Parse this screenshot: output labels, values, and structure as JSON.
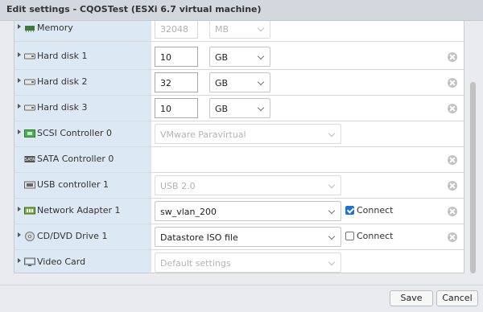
{
  "window": {
    "title": "Edit settings - CQOSTest (ESXi 6.7 virtual machine)"
  },
  "colors": {
    "label_column": "#dce8f3",
    "accent": "#1b73d8"
  },
  "rows": [
    {
      "label": "Memory",
      "icon": "memory-icon",
      "value": "32048",
      "unit": "MB",
      "disabled": true
    },
    {
      "label": "Hard disk 1",
      "icon": "hard-disk-icon",
      "value": "10",
      "unit": "GB"
    },
    {
      "label": "Hard disk 2",
      "icon": "hard-disk-icon",
      "value": "32",
      "unit": "GB"
    },
    {
      "label": "Hard disk 3",
      "icon": "hard-disk-icon",
      "value": "10",
      "unit": "GB"
    },
    {
      "label": "SCSI Controller 0",
      "icon": "scsi-controller-icon",
      "select": "VMware Paravirtual",
      "disabled": true
    },
    {
      "label": "SATA Controller 0",
      "icon": "sata-controller-icon"
    },
    {
      "label": "USB controller 1",
      "icon": "usb-icon",
      "select": "USB 2.0",
      "disabled": true
    },
    {
      "label": "Network Adapter 1",
      "icon": "network-adapter-icon",
      "select": "sw_vlan_200",
      "connect_label": "Connect",
      "connected": true
    },
    {
      "label": "CD/DVD Drive 1",
      "icon": "cd-dvd-icon",
      "select": "Datastore ISO file",
      "connect_label": "Connect",
      "connected": false
    },
    {
      "label": "Video Card",
      "icon": "video-card-icon",
      "select": "Default settings",
      "disabled": true
    }
  ],
  "footer": {
    "save_label": "Save",
    "cancel_label": "Cancel"
  }
}
